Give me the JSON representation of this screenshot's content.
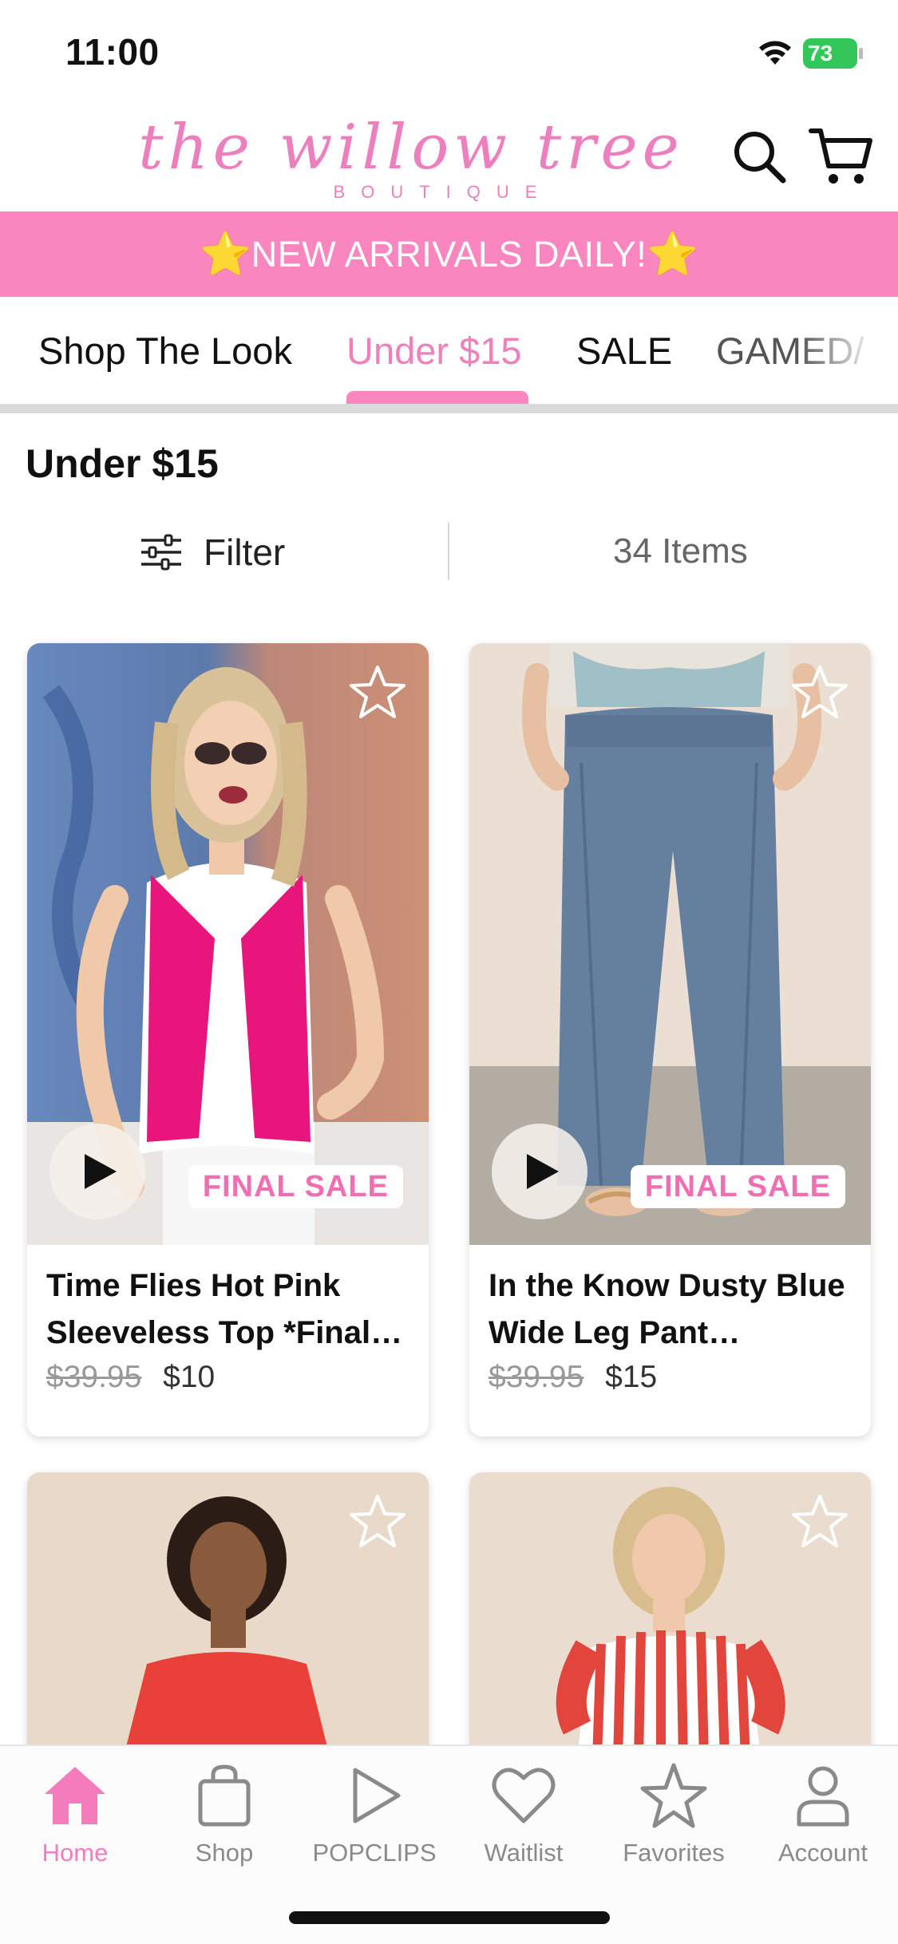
{
  "status_bar": {
    "time": "11:00",
    "battery": "73"
  },
  "header": {
    "logo_script": "the willow tree",
    "logo_sub": "BOUTIQUE",
    "search_icon": "search-icon",
    "cart_icon": "cart-icon"
  },
  "banner": {
    "text": "NEW ARRIVALS DAILY!",
    "star": "⭐"
  },
  "tabs": [
    {
      "label": "Shop The Look"
    },
    {
      "label": "Under $15"
    },
    {
      "label": "SALE"
    },
    {
      "label": "GAMED/"
    }
  ],
  "active_tab": "Under $15",
  "section": {
    "title": "Under $15"
  },
  "filter": {
    "label": "Filter",
    "items_count": "34 Items"
  },
  "products": [
    {
      "title": "Time Flies Hot Pink Sleeveless Top *Final…",
      "price_old": "$39.95",
      "price": "$10",
      "badge": "FINAL SALE"
    },
    {
      "title": "In the Know Dusty Blue Wide Leg Pant…",
      "price_old": "$39.95",
      "price": "$15",
      "badge": "FINAL SALE"
    },
    {
      "title": "",
      "price_old": "",
      "price": "",
      "badge": ""
    },
    {
      "title": "",
      "price_old": "",
      "price": "",
      "badge": ""
    }
  ],
  "bottom_nav": [
    {
      "label": "Home",
      "icon": "home-icon",
      "active": true
    },
    {
      "label": "Shop",
      "icon": "bag-icon",
      "active": false
    },
    {
      "label": "POPCLIPS",
      "icon": "play-icon",
      "active": false
    },
    {
      "label": "Waitlist",
      "icon": "heart-icon",
      "active": false
    },
    {
      "label": "Favorites",
      "icon": "star-icon",
      "active": false
    },
    {
      "label": "Account",
      "icon": "person-icon",
      "active": false
    }
  ],
  "colors": {
    "brand_pink": "#f986bf",
    "accent_text": "#f07fba",
    "badge_pink": "#f06eb2",
    "battery_green": "#33c759"
  }
}
